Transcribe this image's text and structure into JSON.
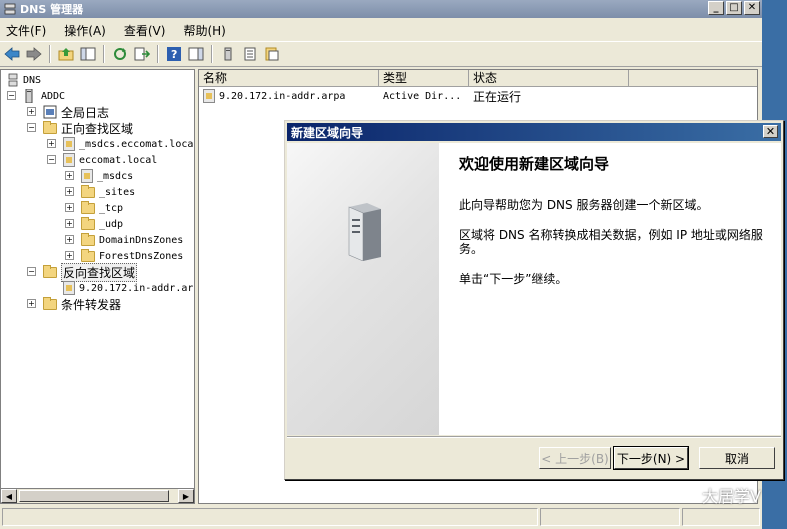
{
  "window": {
    "title": "DNS 管理器"
  },
  "menu": [
    "文件(F)",
    "操作(A)",
    "查看(V)",
    "帮助(H)"
  ],
  "tree": {
    "root": "DNS",
    "server": "ADDC",
    "global_logs": "全局日志",
    "forward_zones": "正向查找区域",
    "msdcs_zone": "_msdcs.eccomat.loca",
    "local_zone": "eccomat.local",
    "local_children": [
      "_msdcs",
      "_sites",
      "_tcp",
      "_udp",
      "DomainDnsZones",
      "ForestDnsZones"
    ],
    "reverse_zones": "反向查找区域",
    "reverse_child": "9.20.172.in-addr.ar",
    "conditional_forwarders": "条件转发器"
  },
  "list": {
    "columns": [
      "名称",
      "类型",
      "状态"
    ],
    "rows": [
      {
        "name": "9.20.172.in-addr.arpa",
        "type": "Active Dir...",
        "status": "正在运行"
      }
    ]
  },
  "wizard": {
    "title": "新建区域向导",
    "heading": "欢迎使用新建区域向导",
    "para1": "此向导帮助您为 DNS 服务器创建一个新区域。",
    "para2": "区域将 DNS 名称转换成相关数据，例如 IP 地址或网络服务。",
    "para3": "单击“下一步”继续。",
    "back": "< 上一步(B)",
    "next": "下一步(N) >",
    "cancel": "取消"
  },
  "watermark": "大居学V"
}
